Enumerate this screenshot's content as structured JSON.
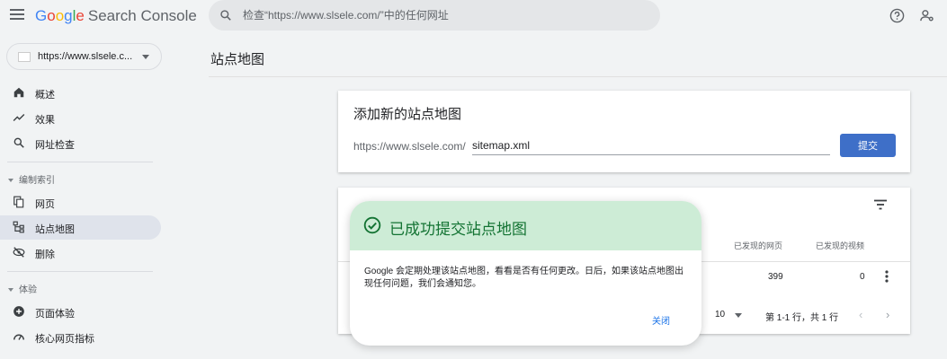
{
  "header": {
    "logo_google": [
      "G",
      "o",
      "o",
      "g",
      "l",
      "e"
    ],
    "logo_product": "Search Console",
    "search_placeholder": "检查“https://www.slsele.com/”中的任何网址"
  },
  "sidebar": {
    "property": "https://www.slsele.c...",
    "items_top": [
      {
        "label": "概述",
        "icon": "home-icon"
      },
      {
        "label": "效果",
        "icon": "trending-up-icon"
      },
      {
        "label": "网址检查",
        "icon": "search-icon"
      }
    ],
    "section_index": "编制索引",
    "items_index": [
      {
        "label": "网页",
        "icon": "pages-icon"
      },
      {
        "label": "站点地图",
        "icon": "sitemap-icon",
        "active": true
      },
      {
        "label": "删除",
        "icon": "removal-icon"
      }
    ],
    "section_experience": "体验",
    "items_experience": [
      {
        "label": "页面体验",
        "icon": "page-experience-icon"
      },
      {
        "label": "核心网页指标",
        "icon": "speed-icon"
      }
    ]
  },
  "main": {
    "page_title": "站点地图",
    "add_card": {
      "title": "添加新的站点地图",
      "url_prefix": "https://www.slsele.com/",
      "input_value": "sitemap.xml",
      "submit_label": "提交"
    },
    "table_card": {
      "col_pages": "已发现的网页",
      "col_videos": "已发现的视频",
      "row_pages": "399",
      "row_videos": "0",
      "rows_per_page": "10",
      "pager_text": "第 1-1 行，共 1 行"
    }
  },
  "dialog": {
    "title": "已成功提交站点地图",
    "body": "Google 会定期处理该站点地图，看看是否有任何更改。日后，如果该站点地图出现任何问题，我们会通知您。",
    "close_label": "关闭"
  },
  "colors": {
    "accent": "#3e6fc8",
    "success_bg": "#cdecd6",
    "success_text": "#137333",
    "link": "#1a73e8"
  }
}
